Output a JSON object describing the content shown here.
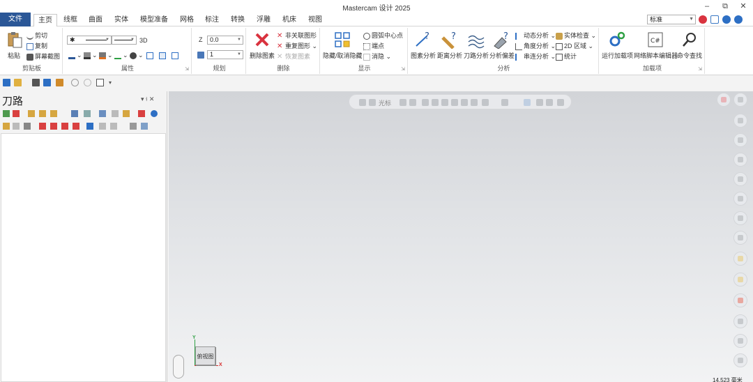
{
  "window": {
    "title": "Mastercam 设计 2025",
    "minimize": "–",
    "restore": "⧉",
    "close": "✕"
  },
  "menu": {
    "tabs": [
      "文件",
      "主页",
      "线框",
      "曲面",
      "实体",
      "模型准备",
      "网格",
      "标注",
      "转换",
      "浮雕",
      "机床",
      "视图"
    ],
    "active": "主页",
    "style_value": "标准"
  },
  "ribbon": {
    "clipboard": {
      "label": "剪贴板",
      "paste": "粘贴",
      "cut": "剪切",
      "copy": "复制",
      "screenshot": "屏幕截图"
    },
    "attributes": {
      "label": "属性",
      "mode_3d": "3D"
    },
    "planes": {
      "label": "规划",
      "z_label": "Z",
      "z_value": "0.0",
      "level_value": "1"
    },
    "delete": {
      "label": "删除",
      "delete_entity": "删除图素",
      "delete_unrelated": "非关联图形",
      "repeat_shape": "重复图形",
      "restore_entity": "恢复图素"
    },
    "display": {
      "label": "显示",
      "hide_unhide": "隐藏/取消隐藏",
      "arc_center": "圆弧中心点",
      "endpoints": "端点",
      "blank": "消隐"
    },
    "analyze": {
      "label": "分析",
      "entity_analysis": "图素分析",
      "distance_analysis": "距离分析",
      "toolpath_analysis": "刀路分析",
      "analysis_deviation": "分析偏差",
      "dynamic_analysis": "动态分析",
      "angle_analysis": "角度分析",
      "chain_analysis": "串连分析",
      "solid_check": "实体检查",
      "area_2d": "2D 区域",
      "statistics": "统计"
    },
    "addins": {
      "label": "加载项",
      "run_addin": "运行加载项",
      "net_script_editor": "网络脚本编辑器",
      "command_finder": "命令查找"
    }
  },
  "panel": {
    "title": "刀路",
    "pin": "▾ ⫮ ✕"
  },
  "viewport": {
    "toolbar_label": "光标",
    "view_cube_label": "俯视图",
    "axis_x": "X",
    "axis_y": "Y",
    "scale_text": "14.523 毫米"
  },
  "colors": {
    "file_tab": "#2b5797",
    "axis_x": "#d62c2c",
    "axis_y": "#2ea043"
  }
}
